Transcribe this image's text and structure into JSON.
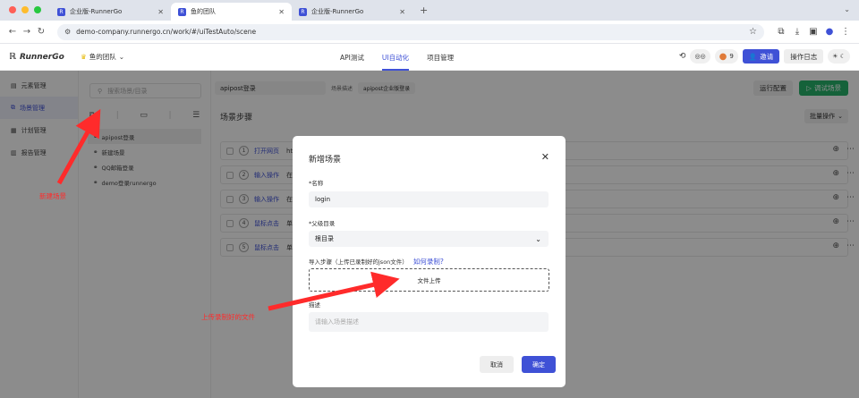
{
  "browser": {
    "tabs": [
      {
        "title": "企业版-RunnerGo",
        "active": false
      },
      {
        "title": "鱼的团队",
        "active": true
      },
      {
        "title": "企业版-RunnerGo",
        "active": false
      }
    ],
    "url": "demo-company.runnergo.cn/work/#/uiTestAuto/scene"
  },
  "header": {
    "logo": "RunnerGo",
    "team": "鱼的团队",
    "nav": [
      "API测试",
      "UI自动化",
      "项目管理"
    ],
    "active_nav": "UI自动化",
    "count_badge": "9",
    "invite": "邀请",
    "op_log": "操作日志"
  },
  "sidebar": {
    "items": [
      {
        "label": "元素管理",
        "icon": "element-icon"
      },
      {
        "label": "场景管理",
        "icon": "scene-icon",
        "active": true
      },
      {
        "label": "计划管理",
        "icon": "calendar-icon"
      },
      {
        "label": "报告管理",
        "icon": "report-icon"
      }
    ]
  },
  "tree": {
    "search_placeholder": "搜索场景/目录",
    "items": [
      "apipost登录",
      "新建场景",
      "QQ邮箱登录",
      "demo登录runnergo"
    ]
  },
  "main": {
    "scene_name": "apipost登录",
    "desc_label": "场景描述",
    "desc_value": "apipost企业版登录",
    "run_config": "运行配置",
    "debug": "调试场景",
    "steps_title": "场景步骤",
    "batch": "批量操作",
    "steps": [
      {
        "num": "1",
        "type": "打开网页",
        "sub": "ht"
      },
      {
        "num": "2",
        "type": "输入操作",
        "sub": "在"
      },
      {
        "num": "3",
        "type": "输入操作",
        "sub": "在"
      },
      {
        "num": "4",
        "type": "鼠标点击",
        "sub": "单"
      },
      {
        "num": "5",
        "type": "鼠标点击",
        "sub": "单"
      }
    ]
  },
  "modal": {
    "title": "新增场景",
    "name_label": "*名称",
    "name_value": "login",
    "parent_label": "*父级目录",
    "parent_value": "根目录",
    "import_label": "导入步骤（上传已录制好的json文件）",
    "how_link": "如何录制?",
    "upload": "文件上传",
    "desc_label": "描述",
    "desc_placeholder": "请输入场景描述",
    "cancel": "取消",
    "ok": "确定"
  },
  "annotations": {
    "new_scene": "新建场景",
    "upload_file": "上传录制好的文件"
  },
  "colors": {
    "accent": "#3f51d6",
    "debug": "#27b36b",
    "annotation": "#ff2b2b"
  }
}
